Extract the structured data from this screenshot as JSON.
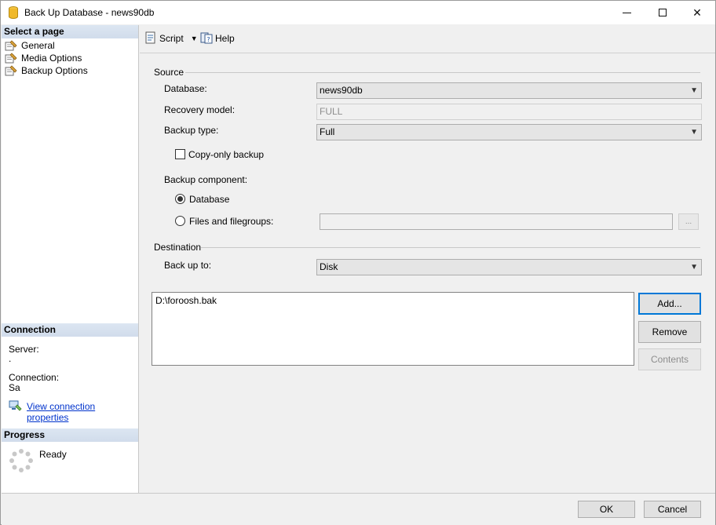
{
  "window": {
    "title": "Back Up Database - news90db",
    "controls": {
      "minimize": "—",
      "maximize": "☐",
      "close": "✕"
    }
  },
  "left": {
    "select_page_header": "Select a page",
    "pages": [
      {
        "label": "General",
        "icon": "page-wrench-icon"
      },
      {
        "label": "Media Options",
        "icon": "page-wrench-icon"
      },
      {
        "label": "Backup Options",
        "icon": "page-wrench-icon"
      }
    ],
    "connection_header": "Connection",
    "server_label": "Server:",
    "server_value": ".",
    "connection_label": "Connection:",
    "connection_value": "Sa",
    "view_props_link": "View connection properties",
    "progress_header": "Progress",
    "progress_status": "Ready"
  },
  "toolbar": {
    "script_label": "Script",
    "help_label": "Help"
  },
  "source": {
    "group_label": "Source",
    "database_label": "Database:",
    "database_value": "news90db",
    "recovery_label": "Recovery model:",
    "recovery_value": "FULL",
    "backup_type_label": "Backup type:",
    "backup_type_value": "Full",
    "copy_only_label": "Copy-only backup",
    "copy_only_checked": false,
    "component_label": "Backup component:",
    "radio_database": "Database",
    "radio_files": "Files and filegroups:",
    "files_value": "",
    "files_browse": "..."
  },
  "destination": {
    "group_label": "Destination",
    "backup_to_label": "Back up to:",
    "backup_to_value": "Disk",
    "files": [
      "D:\\foroosh.bak"
    ],
    "add_label": "Add...",
    "remove_label": "Remove",
    "contents_label": "Contents"
  },
  "footer": {
    "ok_label": "OK",
    "cancel_label": "Cancel"
  }
}
